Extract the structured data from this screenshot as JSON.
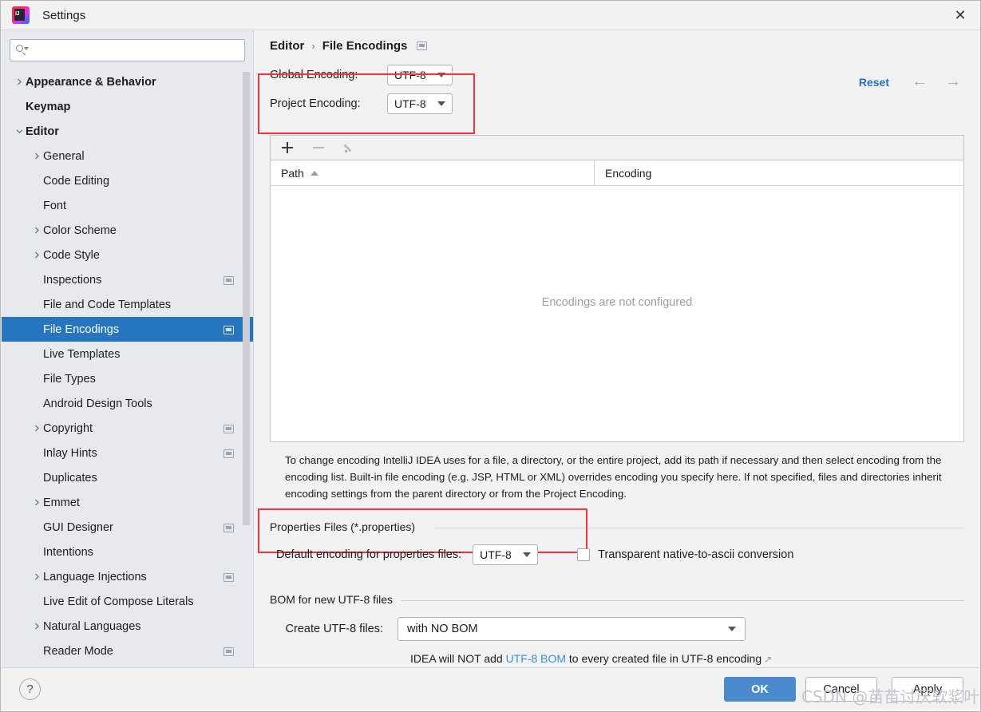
{
  "window": {
    "title": "Settings",
    "app_icon": "intellij-idea-icon",
    "close_label": "✕"
  },
  "sidebar": {
    "search": {
      "value": "",
      "placeholder": ""
    },
    "items": [
      {
        "label": "Appearance & Behavior",
        "indent": 0,
        "arrow": "right",
        "bold": true,
        "panel": false,
        "selected": false
      },
      {
        "label": "Keymap",
        "indent": 0,
        "arrow": "none",
        "bold": true,
        "panel": false,
        "selected": false
      },
      {
        "label": "Editor",
        "indent": 0,
        "arrow": "down",
        "bold": true,
        "panel": false,
        "selected": false
      },
      {
        "label": "General",
        "indent": 1,
        "arrow": "right",
        "bold": false,
        "panel": false,
        "selected": false
      },
      {
        "label": "Code Editing",
        "indent": 1,
        "arrow": "none",
        "bold": false,
        "panel": false,
        "selected": false
      },
      {
        "label": "Font",
        "indent": 1,
        "arrow": "none",
        "bold": false,
        "panel": false,
        "selected": false
      },
      {
        "label": "Color Scheme",
        "indent": 1,
        "arrow": "right",
        "bold": false,
        "panel": false,
        "selected": false
      },
      {
        "label": "Code Style",
        "indent": 1,
        "arrow": "right",
        "bold": false,
        "panel": false,
        "selected": false
      },
      {
        "label": "Inspections",
        "indent": 1,
        "arrow": "none",
        "bold": false,
        "panel": true,
        "selected": false
      },
      {
        "label": "File and Code Templates",
        "indent": 1,
        "arrow": "none",
        "bold": false,
        "panel": false,
        "selected": false
      },
      {
        "label": "File Encodings",
        "indent": 1,
        "arrow": "none",
        "bold": false,
        "panel": true,
        "selected": true
      },
      {
        "label": "Live Templates",
        "indent": 1,
        "arrow": "none",
        "bold": false,
        "panel": false,
        "selected": false
      },
      {
        "label": "File Types",
        "indent": 1,
        "arrow": "none",
        "bold": false,
        "panel": false,
        "selected": false
      },
      {
        "label": "Android Design Tools",
        "indent": 1,
        "arrow": "none",
        "bold": false,
        "panel": false,
        "selected": false
      },
      {
        "label": "Copyright",
        "indent": 1,
        "arrow": "right",
        "bold": false,
        "panel": true,
        "selected": false
      },
      {
        "label": "Inlay Hints",
        "indent": 1,
        "arrow": "none",
        "bold": false,
        "panel": true,
        "selected": false
      },
      {
        "label": "Duplicates",
        "indent": 1,
        "arrow": "none",
        "bold": false,
        "panel": false,
        "selected": false
      },
      {
        "label": "Emmet",
        "indent": 1,
        "arrow": "right",
        "bold": false,
        "panel": false,
        "selected": false
      },
      {
        "label": "GUI Designer",
        "indent": 1,
        "arrow": "none",
        "bold": false,
        "panel": true,
        "selected": false
      },
      {
        "label": "Intentions",
        "indent": 1,
        "arrow": "none",
        "bold": false,
        "panel": false,
        "selected": false
      },
      {
        "label": "Language Injections",
        "indent": 1,
        "arrow": "right",
        "bold": false,
        "panel": true,
        "selected": false
      },
      {
        "label": "Live Edit of Compose Literals",
        "indent": 1,
        "arrow": "none",
        "bold": false,
        "panel": false,
        "selected": false
      },
      {
        "label": "Natural Languages",
        "indent": 1,
        "arrow": "right",
        "bold": false,
        "panel": false,
        "selected": false
      },
      {
        "label": "Reader Mode",
        "indent": 1,
        "arrow": "none",
        "bold": false,
        "panel": true,
        "selected": false
      }
    ]
  },
  "main": {
    "breadcrumb": {
      "parent": "Editor",
      "separator": "›",
      "current": "File Encodings"
    },
    "reset_label": "Reset",
    "nav_back": "←",
    "nav_forward": "→",
    "global_encoding": {
      "label": "Global Encoding:",
      "value": "UTF-8"
    },
    "project_encoding": {
      "label": "Project Encoding:",
      "value": "UTF-8"
    },
    "toolbar": {
      "add": "+",
      "remove": "−",
      "edit": "pencil"
    },
    "table": {
      "columns": [
        "Path",
        "Encoding"
      ],
      "sort_column": "Path",
      "sort_direction": "asc",
      "rows": [],
      "empty_message": "Encodings are not configured"
    },
    "description": "To change encoding IntelliJ IDEA uses for a file, a directory, or the entire project, add its path if necessary and then select encoding from the encoding list. Built-in file encoding (e.g. JSP, HTML or XML) overrides encoding you specify here. If not specified, files and directories inherit encoding settings from the parent directory or from the Project Encoding.",
    "properties_section": {
      "title": "Properties Files (*.properties)",
      "default_encoding_label": "Default encoding for properties files:",
      "default_encoding_value": "UTF-8",
      "transparent_label": "Transparent native-to-ascii conversion",
      "transparent_checked": false
    },
    "bom_section": {
      "title": "BOM for new UTF-8 files",
      "create_label": "Create UTF-8 files:",
      "create_value": "with NO BOM",
      "note_prefix": "IDEA will NOT add ",
      "note_link": "UTF-8 BOM",
      "note_suffix": " to every created file in UTF-8 encoding",
      "external_icon": "↗"
    }
  },
  "bottom": {
    "help": "?",
    "ok": "OK",
    "cancel": "Cancel",
    "apply": "Apply"
  },
  "watermark": {
    "text": "CSDN @苗苗讨厌软浆叶"
  },
  "colors": {
    "selection_blue": "#2675bf",
    "link_blue": "#2470c4",
    "annotation_red": "#f5333f",
    "ok_button_blue": "#4a8ccb",
    "sidebar_bg": "#e6eaee"
  }
}
